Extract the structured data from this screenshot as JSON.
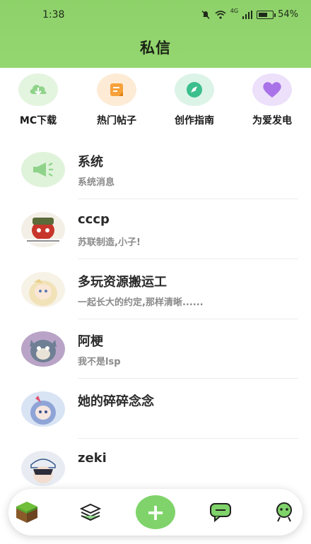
{
  "status": {
    "time": "1:38",
    "network": "4G",
    "battery": "54%"
  },
  "header": {
    "title": "私信"
  },
  "quick": [
    {
      "label": "MC下载",
      "icon": "cloud-download-icon",
      "color": "#8fd38a"
    },
    {
      "label": "热门帖子",
      "icon": "post-note-icon",
      "color": "#f6a13a"
    },
    {
      "label": "创作指南",
      "icon": "compass-icon",
      "color": "#3bbf8c"
    },
    {
      "label": "为爱发电",
      "icon": "heart-icon",
      "color": "#a972e8"
    }
  ],
  "messages": [
    {
      "name": "系统",
      "preview": "系统消息"
    },
    {
      "name": "cccp",
      "preview": "苏联制造,小子!"
    },
    {
      "name": "多玩资源搬运工",
      "preview": "一起长大的约定,那样清晰......"
    },
    {
      "name": "阿梗",
      "preview": "我不是lsp"
    },
    {
      "name": "她的碎碎念念",
      "preview": ""
    },
    {
      "name": "zeki",
      "preview": ""
    }
  ],
  "nav": {
    "add_symbol": "+"
  },
  "colors": {
    "accent": "#8ed16a",
    "add_button": "#7fd36a"
  }
}
